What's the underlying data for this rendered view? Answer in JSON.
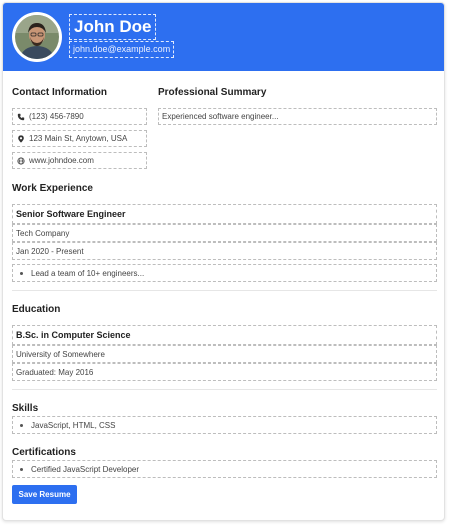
{
  "header": {
    "name": "John Doe",
    "email": "john.doe@example.com",
    "bg_color": "#2d6ff0"
  },
  "contact": {
    "title": "Contact Information",
    "phone": "(123) 456-7890",
    "address": "123 Main St, Anytown, USA",
    "website": "www.johndoe.com",
    "icons": [
      "phone-icon",
      "map-pin-icon",
      "globe-icon"
    ]
  },
  "summary": {
    "title": "Professional Summary",
    "text": "Experienced software engineer..."
  },
  "work": {
    "title": "Work Experience",
    "job_title": "Senior Software Engineer",
    "company": "Tech Company",
    "dates": "Jan 2020 - Present",
    "bullet": "Lead a team of 10+ engineers..."
  },
  "education": {
    "title": "Education",
    "degree": "B.Sc. in Computer Science",
    "school": "University of Somewhere",
    "graduated": "Graduated: May 2016"
  },
  "skills": {
    "title": "Skills",
    "item": "JavaScript, HTML, CSS"
  },
  "certifications": {
    "title": "Certifications",
    "item": "Certified JavaScript Developer"
  },
  "actions": {
    "save_label": "Save Resume",
    "accent": "#2d6ff0"
  }
}
